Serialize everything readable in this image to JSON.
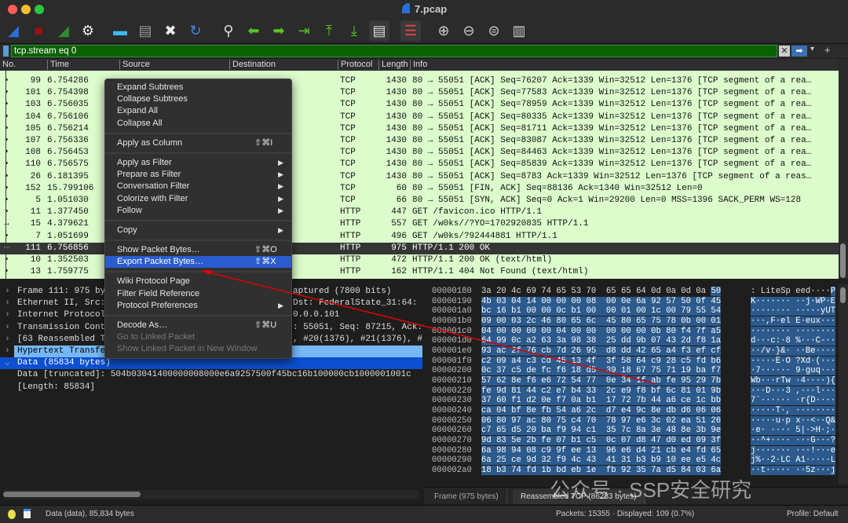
{
  "window": {
    "title": "7.pcap"
  },
  "toolbar": {
    "icons": [
      "shark-fin-start-icon",
      "stop-capture-icon",
      "restart-capture-icon",
      "capture-options-gear-icon",
      "open-folder-icon",
      "save-file-icon",
      "close-file-icon",
      "reload-file-icon",
      "find-packet-magnifier-icon",
      "go-back-arrow-icon",
      "go-forward-arrow-icon",
      "go-to-packet-icon",
      "go-to-first-packet-icon",
      "go-to-last-packet-icon",
      "auto-scroll-icon",
      "colorize-icon",
      "zoom-in-icon",
      "zoom-out-icon",
      "zoom-normal-icon",
      "resize-columns-icon"
    ]
  },
  "filter": {
    "value": "tcp.stream eq 0"
  },
  "packet_list": {
    "columns": [
      "No.",
      "Time",
      "Source",
      "Destination",
      "Protocol",
      "Length",
      "Info"
    ],
    "rows": [
      {
        "no": "99",
        "time": "6.754286",
        "proto": "TCP",
        "len": "1430",
        "info": "80 → 55051 [ACK] Seq=76207 Ack=1339 Win=32512 Len=1376 [TCP segment of a rea…"
      },
      {
        "no": "101",
        "time": "6.754398",
        "proto": "TCP",
        "len": "1430",
        "info": "80 → 55051 [ACK] Seq=77583 Ack=1339 Win=32512 Len=1376 [TCP segment of a rea…"
      },
      {
        "no": "103",
        "time": "6.756035",
        "proto": "TCP",
        "len": "1430",
        "info": "80 → 55051 [ACK] Seq=78959 Ack=1339 Win=32512 Len=1376 [TCP segment of a rea…"
      },
      {
        "no": "104",
        "time": "6.756106",
        "proto": "TCP",
        "len": "1430",
        "info": "80 → 55051 [ACK] Seq=80335 Ack=1339 Win=32512 Len=1376 [TCP segment of a rea…"
      },
      {
        "no": "105",
        "time": "6.756214",
        "proto": "TCP",
        "len": "1430",
        "info": "80 → 55051 [ACK] Seq=81711 Ack=1339 Win=32512 Len=1376 [TCP segment of a rea…"
      },
      {
        "no": "107",
        "time": "6.756336",
        "proto": "TCP",
        "len": "1430",
        "info": "80 → 55051 [ACK] Seq=83087 Ack=1339 Win=32512 Len=1376 [TCP segment of a rea…"
      },
      {
        "no": "108",
        "time": "6.756453",
        "proto": "TCP",
        "len": "1430",
        "info": "80 → 55051 [ACK] Seq=84463 Ack=1339 Win=32512 Len=1376 [TCP segment of a rea…"
      },
      {
        "no": "110",
        "time": "6.756575",
        "proto": "TCP",
        "len": "1430",
        "info": "80 → 55051 [ACK] Seq=85839 Ack=1339 Win=32512 Len=1376 [TCP segment of a rea…"
      },
      {
        "no": "26",
        "time": "6.181395",
        "proto": "TCP",
        "len": "1430",
        "info": "80 → 55051 [ACK] Seq=8783 Ack=1339 Win=32512 Len=1376 [TCP segment of a reas…"
      },
      {
        "no": "152",
        "time": "15.799106",
        "proto": "TCP",
        "len": "60",
        "info": "80 → 55051 [FIN, ACK] Seq=88136 Ack=1340 Win=32512 Len=0"
      },
      {
        "no": "5",
        "time": "1.051030",
        "proto": "TCP",
        "len": "66",
        "info": "80 → 55051 [SYN, ACK] Seq=0 Ack=1 Win=29200 Len=0 MSS=1396 SACK_PERM WS=128"
      },
      {
        "no": "11",
        "time": "1.377450",
        "proto": "HTTP",
        "len": "447",
        "info": "GET /favicon.ico HTTP/1.1"
      },
      {
        "no": "15",
        "time": "4.379621",
        "proto": "HTTP",
        "len": "557",
        "info": "GET /w0ks//?YO=1702920835 HTTP/1.1"
      },
      {
        "no": "7",
        "time": "1.051699",
        "proto": "HTTP",
        "len": "496",
        "info": "GET /w0ks/?92444881 HTTP/1.1"
      },
      {
        "no": "111",
        "time": "6.756856",
        "proto": "HTTP",
        "len": "975",
        "info": "HTTP/1.1 200 OK",
        "selected": true
      },
      {
        "no": "10",
        "time": "1.352503",
        "proto": "HTTP",
        "len": "472",
        "info": "HTTP/1.1 200 OK  (text/html)"
      },
      {
        "no": "13",
        "time": "1.759775",
        "proto": "HTTP",
        "len": "162",
        "info": "HTTP/1.1 404 Not Found  (text/html)"
      }
    ]
  },
  "details": [
    {
      "arrow": "›",
      "left": "Frame 111: 975 by",
      "right": "aptured (7800 bits)"
    },
    {
      "arrow": "›",
      "left": "Ethernet II, Src:",
      "right": " Dst: FederalState_31:64:"
    },
    {
      "arrow": "›",
      "left": "Internet Protocol",
      "right": "0.0.0.101"
    },
    {
      "arrow": "›",
      "left": "Transmission Cont",
      "right": ": 55051, Seq: 87215, Ack:"
    },
    {
      "arrow": "›",
      "left": "[63 Reassembled T",
      "right": ", #20(1376), #21(1376), #"
    },
    {
      "arrow": "›",
      "left": "Hypertext Transfe",
      "right": "",
      "style": "hover"
    },
    {
      "arrow": "⌄",
      "left": "Data (85834 bytes)",
      "right": "",
      "style": "selected"
    },
    {
      "arrow": "",
      "left": "   Data [truncated]: 504b03041400000008000e6a9257500f45bc16b100000cb1000001001c",
      "right": ""
    },
    {
      "arrow": "",
      "left": "   [Length: 85834]",
      "right": ""
    }
  ],
  "hex": [
    {
      "off": "00000180",
      "hex": "3a 20 4c 69 74 65 53 70  65 65 64 0d 0a 0d 0a ",
      "hex_sel": "50",
      "ascii": ": LiteSp eed····",
      "ascii_sel": "P"
    },
    {
      "off": "00000190",
      "hex": "",
      "hex_sel": "4b 03 04 14 00 00 00 08  00 0e 6a 92 57 50 0f 45",
      "ascii": "",
      "ascii_sel": "K······· ··j·WP·E"
    },
    {
      "off": "000001a0",
      "hex": "",
      "hex_sel": "bc 16 b1 00 00 0c b1 00  00 01 00 1c 00 79 55 54",
      "ascii": "",
      "ascii_sel": "········ ·····yUT"
    },
    {
      "off": "000001b0",
      "hex": "",
      "hex_sel": "09 00 03 2c 46 80 65 6c  45 80 65 75 78 0b 00 01",
      "ascii": "",
      "ascii_sel": "···,F·el E·eux···"
    },
    {
      "off": "000001c0",
      "hex": "",
      "hex_sel": "04 00 00 00 00 04 00 00  00 00 00 0b 80 f4 7f a5",
      "ascii": "",
      "ascii_sel": "········ ········"
    },
    {
      "off": "000001d0",
      "hex": "",
      "hex_sel": "64 99 0c a2 63 3a 98 38  25 dd 9b 07 43 2d f8 1a",
      "ascii": "",
      "ascii_sel": "d···c:·8 %···C-··"
    },
    {
      "off": "000001e0",
      "hex": "",
      "hex_sel": "93 ac 2f 76 cb 7d 26 95  d8 dd 42 65 a4 f3 ef cf",
      "ascii": "",
      "ascii_sel": "··/v·}&· ··Be····"
    },
    {
      "off": "000001f0",
      "hex": "",
      "hex_sel": "c2 09 a4 c3 cd 45 13 4f  3f 58 64 c9 28 c5 fd b6",
      "ascii": "",
      "ascii_sel": "·····E·O ?Xd·(···"
    },
    {
      "off": "00000200",
      "hex": "",
      "hex_sel": "0c 37 c5 de fc f6 18 d5  39 18 67 75 71 19 ba f7",
      "ascii": "",
      "ascii_sel": "·7······ 9·guq···"
    },
    {
      "off": "00000210",
      "hex": "",
      "hex_sel": "57 62 8e f6 e6 72 54 77  0e 34 1f ab fe 95 29 7b",
      "ascii": "",
      "ascii_sel": "Wb···rTw ·4····){"
    },
    {
      "off": "00000220",
      "hex": "",
      "hex_sel": "fe 9d 81 44 c2 e7 b4 33  2c e9 f8 bf 6c 81 01 9b",
      "ascii": "",
      "ascii_sel": "···D···3 ,···l···"
    },
    {
      "off": "00000230",
      "hex": "",
      "hex_sel": "37 60 f1 d2 0e f7 0a b1  17 72 7b 44 a6 ce 1c bb",
      "ascii": "",
      "ascii_sel": "7`······ ·r{D····"
    },
    {
      "off": "00000240",
      "hex": "",
      "hex_sel": "ca 04 bf 8e fb 54 a6 2c  d7 e4 9c 8e db d6 06 06",
      "ascii": "",
      "ascii_sel": "·····T·, ········"
    },
    {
      "off": "00000250",
      "hex": "",
      "hex_sel": "06 80 97 ac 80 75 c4 70  78 97 e6 3c 02 ea 51 26",
      "ascii": "",
      "ascii_sel": "·····u·p x··<··Q&"
    },
    {
      "off": "00000260",
      "hex": "",
      "hex_sel": "c7 65 d5 20 ba f9 94 c1  35 7c 8a 3e 48 8e 3b 9e",
      "ascii": "",
      "ascii_sel": "·e· ···· 5|·>H·;·"
    },
    {
      "off": "00000270",
      "hex": "",
      "hex_sel": "9d 83 5e 2b fe 07 b1 c5  0c 07 d8 47 d0 ed 09 3f",
      "ascii": "",
      "ascii_sel": "··^+···· ···G···?"
    },
    {
      "off": "00000280",
      "hex": "",
      "hex_sel": "6a 98 94 08 c9 9f ee 13  96 e6 d4 21 cb e4 fd 65",
      "ascii": "",
      "ascii_sel": "j······· ···!···e"
    },
    {
      "off": "00000290",
      "hex": "",
      "hex_sel": "6a 25 ce 9d 32 f9 4c 43  41 31 b3 b9 10 ee e5 4c",
      "ascii": "",
      "ascii_sel": "j%··2·LC A1·····L"
    },
    {
      "off": "000002a0",
      "hex": "",
      "hex_sel": "18 b3 74 fd 1b bd eb 1e  fb 92 35 7a d5 84 03 6a",
      "ascii": "",
      "ascii_sel": "··t····· ··5z···j"
    }
  ],
  "bytes_tabs": [
    {
      "label": "Frame (975 bytes)"
    },
    {
      "label": "Reassembled TCP (86233 bytes)",
      "active": true
    }
  ],
  "context_menu": [
    {
      "label": "Expand Subtrees"
    },
    {
      "label": "Collapse Subtrees"
    },
    {
      "label": "Expand All"
    },
    {
      "label": "Collapse All"
    },
    {
      "sep": true
    },
    {
      "label": "Apply as Column",
      "shortcut": "⇧⌘I"
    },
    {
      "sep": true
    },
    {
      "label": "Apply as Filter",
      "submenu": true
    },
    {
      "label": "Prepare as Filter",
      "submenu": true
    },
    {
      "label": "Conversation Filter",
      "submenu": true
    },
    {
      "label": "Colorize with Filter",
      "submenu": true
    },
    {
      "label": "Follow",
      "submenu": true
    },
    {
      "sep": true
    },
    {
      "label": "Copy",
      "submenu": true
    },
    {
      "sep": true
    },
    {
      "label": "Show Packet Bytes…",
      "shortcut": "⇧⌘O"
    },
    {
      "label": "Export Packet Bytes…",
      "shortcut": "⇧⌘X",
      "highlighted": true
    },
    {
      "sep": true
    },
    {
      "label": "Wiki Protocol Page"
    },
    {
      "label": "Filter Field Reference"
    },
    {
      "label": "Protocol Preferences",
      "submenu": true
    },
    {
      "sep": true
    },
    {
      "label": "Decode As…",
      "shortcut": "⇧⌘U"
    },
    {
      "label": "Go to Linked Packet",
      "disabled": true
    },
    {
      "label": "Show Linked Packet in New Window",
      "disabled": true
    }
  ],
  "status": {
    "left": "Data (data), 85,834 bytes",
    "packets": "Packets: 15355 · Displayed: 109 (0.7%)",
    "profile": "Profile: Default"
  },
  "watermark": "公众号 · SSP安全研究",
  "colors": {
    "packet_bg": "#dcfccc",
    "filter_bg": "#0b6000",
    "selection": "#2c5a8c",
    "menu_highlight": "#2a5ccf",
    "annotation_arrow": "#e00000"
  }
}
